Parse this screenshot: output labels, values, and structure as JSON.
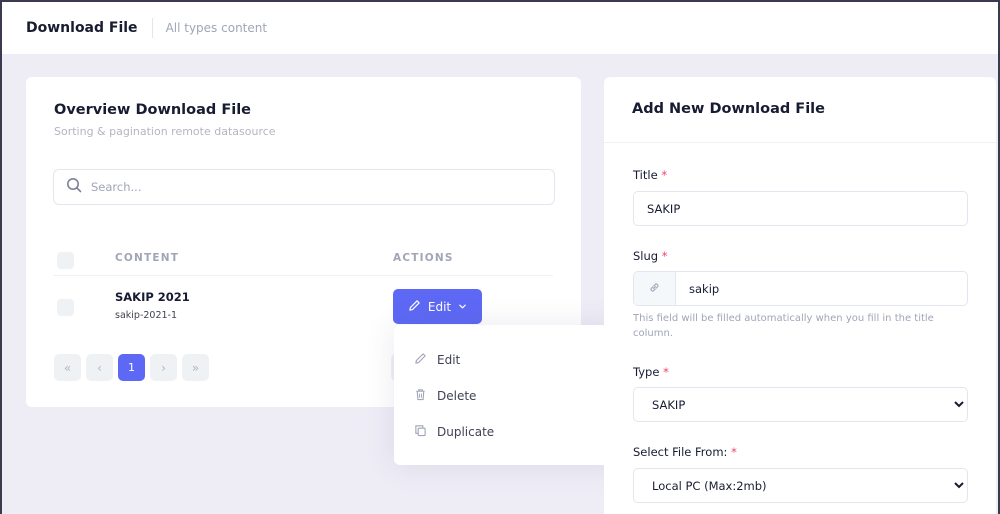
{
  "header": {
    "title": "Download File",
    "subtitle": "All types content"
  },
  "overview": {
    "title": "Overview Download File",
    "subtitle": "Sorting & pagination remote datasource",
    "search": {
      "placeholder": "Search...",
      "value": ""
    },
    "columns": [
      "CONTENT",
      "ACTIONS"
    ],
    "rows": [
      {
        "name": "SAKIP 2021",
        "slug": "sakip-2021-1",
        "action_label": "Edit",
        "checked": false
      }
    ],
    "pagination": {
      "first": "«",
      "prev": "‹",
      "current": "1",
      "next": "›",
      "last": "»"
    },
    "dropdown": {
      "items": [
        {
          "label": "Edit",
          "icon": "pencil-icon"
        },
        {
          "label": "Delete",
          "icon": "trash-icon"
        },
        {
          "label": "Duplicate",
          "icon": "copy-icon"
        }
      ]
    }
  },
  "form": {
    "title": "Add New Download File",
    "title_field": {
      "label": "Title",
      "required_mark": "*",
      "value": "SAKIP"
    },
    "slug_field": {
      "label": "Slug",
      "required_mark": "*",
      "value": "sakip",
      "icon": "link-icon",
      "help": "This field will be filled automatically when you fill in the title column."
    },
    "type_field": {
      "label": "Type",
      "required_mark": "*",
      "value": "SAKIP"
    },
    "file_from_field": {
      "label": "Select File From:",
      "required_mark": "*",
      "value": "Local PC (Max:2mb)"
    }
  },
  "colors": {
    "primary": "#5d69f5",
    "background": "#eeedf6",
    "required": "#f1416c",
    "muted": "#a1a5b7"
  }
}
